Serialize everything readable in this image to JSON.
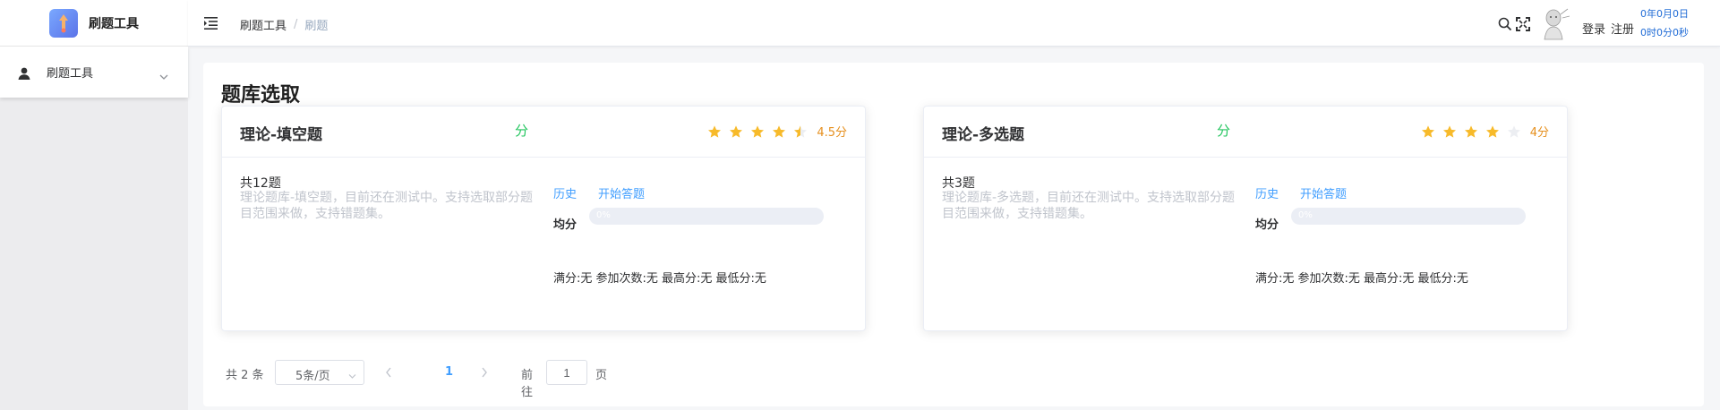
{
  "app": {
    "title": "刷题工具"
  },
  "breadcrumb": [
    "刷题工具",
    "刷题"
  ],
  "breadcrumb_sep": "/",
  "header": {
    "login_label": "登录",
    "register_label": "注册",
    "timer_date": "0年0月0日",
    "timer_time": "0时0分0秒"
  },
  "sidebar": {
    "items": [
      {
        "label": "刷题工具",
        "icon": "user-icon"
      }
    ]
  },
  "main": {
    "title": "题库选取",
    "cards": [
      {
        "title": "理论-填空题",
        "score": "分",
        "rating": 4.5,
        "rating_text": "4.5分",
        "count": "共12题",
        "description": "理论题库-填空题，目前还在测试中。支持选取部分题目范围来做，支持错题集。",
        "history_label": "历史",
        "start_label": "开始答题",
        "avg_label": "均分",
        "progress": 0,
        "progress_text": "0%",
        "stats": "满分:无 参加次数:无 最高分:无 最低分:无"
      },
      {
        "title": "理论-多选题",
        "score": "分",
        "rating": 4,
        "rating_text": "4分",
        "count": "共3题",
        "description": "理论题库-多选题，目前还在测试中。支持选取部分题目范围来做，支持错题集。",
        "history_label": "历史",
        "start_label": "开始答题",
        "avg_label": "均分",
        "progress": 0,
        "progress_text": "0%",
        "stats": "满分:无 参加次数:无 最高分:无 最低分:无"
      }
    ]
  },
  "pagination": {
    "total_text": "共 2 条",
    "page_size": "5条/页",
    "current_page": "1",
    "goto_label": "前往",
    "goto_value": "1",
    "page_suffix": "页"
  },
  "colors": {
    "accent": "#409eff",
    "star": "#f7ba2a",
    "score_green": "#22c55e",
    "rating_text": "#e6901f"
  }
}
